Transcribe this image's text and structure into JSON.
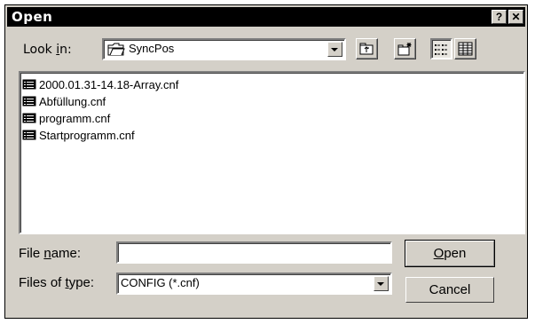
{
  "window": {
    "title": "Open",
    "help_label": "?",
    "close_label": "✕"
  },
  "look_in": {
    "label_pre": "Look ",
    "label_accel": "i",
    "label_post": "n:",
    "folder": "SyncPos"
  },
  "files": [
    {
      "name": "2000.01.31-14.18-Array.cnf",
      "icon": "config-file-icon"
    },
    {
      "name": "Abfüllung.cnf",
      "icon": "config-file-icon"
    },
    {
      "name": "programm.cnf",
      "icon": "config-file-icon"
    },
    {
      "name": "Startprogramm.cnf",
      "icon": "config-file-icon"
    }
  ],
  "file_name": {
    "label_pre": "File ",
    "label_accel": "n",
    "label_post": "ame:",
    "value": ""
  },
  "file_type": {
    "label_pre": "Files of ",
    "label_accel": "t",
    "label_post": "ype:",
    "value": "CONFIG  (*.cnf)"
  },
  "buttons": {
    "open_accel": "O",
    "open_rest": "pen",
    "cancel": "Cancel"
  },
  "toolbar_icons": [
    "up-folder-icon",
    "new-folder-icon",
    "list-view-icon",
    "details-view-icon"
  ],
  "colors": {
    "face": "#d4d0c8",
    "title_bar": "#000000",
    "window": "#ffffff"
  }
}
